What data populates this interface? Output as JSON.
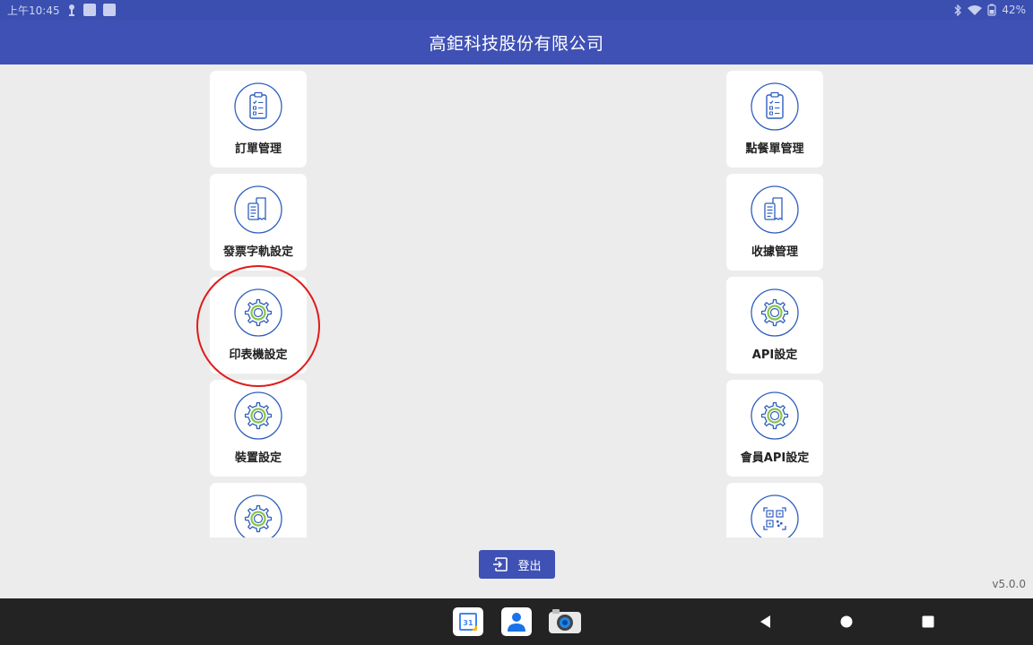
{
  "status_bar": {
    "time": "上午10:45",
    "battery": "42%"
  },
  "app_bar": {
    "title": "高鉅科技股份有限公司"
  },
  "menu_left": [
    {
      "label": "訂單管理",
      "icon": "clipboard-icon"
    },
    {
      "label": "發票字軌設定",
      "icon": "receipt-icon"
    },
    {
      "label": "印表機設定",
      "icon": "gear-icon"
    },
    {
      "label": "裝置設定",
      "icon": "gear-icon"
    },
    {
      "label": "",
      "icon": "gear-icon"
    }
  ],
  "menu_right": [
    {
      "label": "點餐單管理",
      "icon": "clipboard-icon"
    },
    {
      "label": "收據管理",
      "icon": "receipt-icon"
    },
    {
      "label": "API設定",
      "icon": "gear-icon"
    },
    {
      "label": "會員API設定",
      "icon": "gear-icon"
    },
    {
      "label": "",
      "icon": "qr-code-icon"
    }
  ],
  "logout": {
    "label": "登出",
    "icon": "logout-icon"
  },
  "version": "v5.0.0",
  "nav": {
    "calendar_day": "31"
  },
  "colors": {
    "primary": "#3f51b5",
    "status_bar": "#3a4fb0",
    "icon_blue": "#2f5fbf",
    "icon_green": "#8bc34a",
    "highlight": "#e01b1b",
    "nav_bar": "#232323"
  }
}
